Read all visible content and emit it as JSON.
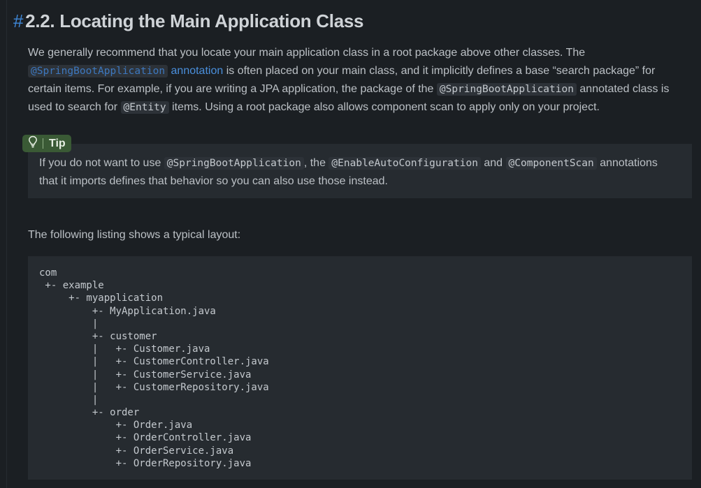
{
  "heading": {
    "anchor": "#",
    "title": "2.2. Locating the Main Application Class"
  },
  "intro": {
    "l1": "We generally recommend that you locate your main application class in a root package above other classes. The",
    "l2_code": "@SpringBootApplication",
    "l2_link": "annotation",
    "l2_rest": " is often placed on your main class, and it implicitly defines a base “search package” for",
    "l3_pre": "certain items. For example, if you are writing a JPA application, the package of the ",
    "l3_code": "@SpringBootApplication",
    "l3_post": " annotated class is",
    "l4_pre": "used to search for ",
    "l4_code": "@Entity",
    "l4_post": " items. Using a root package also allows component scan to apply only on your project."
  },
  "tip": {
    "label": "Tip",
    "icon": "lightbulb-icon",
    "badge_color": "#3a5a35",
    "t1_pre": "If you do not want to use ",
    "t1_code1": "@SpringBootApplication",
    "t1_mid1": ", the ",
    "t1_code2": "@EnableAutoConfiguration",
    "t1_mid2": " and ",
    "t1_code3": "@ComponentScan",
    "t1_post": " annotations",
    "t2": "that it imports defines that behavior so you can also use those instead."
  },
  "listing_intro": "The following listing shows a typical layout:",
  "code_listing": [
    "com",
    " +- example",
    "     +- myapplication",
    "         +- MyApplication.java",
    "         |",
    "         +- customer",
    "         |   +- Customer.java",
    "         |   +- CustomerController.java",
    "         |   +- CustomerService.java",
    "         |   +- CustomerRepository.java",
    "         |",
    "         +- order",
    "             +- Order.java",
    "             +- OrderController.java",
    "             +- OrderService.java",
    "             +- OrderRepository.java"
  ]
}
